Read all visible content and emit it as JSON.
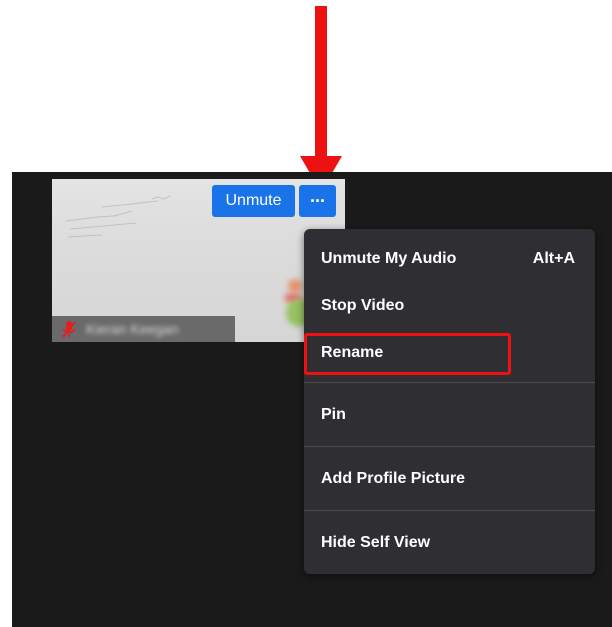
{
  "tile": {
    "unmute_label": "Unmute",
    "more_label": "···",
    "participant_name": "Kieran Keegan",
    "icons": {
      "mic": "mic-muted-icon"
    }
  },
  "menu": {
    "items": [
      {
        "label": "Unmute My Audio",
        "shortcut": "Alt+A"
      },
      {
        "label": "Stop Video"
      },
      {
        "label": "Rename"
      },
      {
        "label": "Pin"
      },
      {
        "label": "Add Profile Picture"
      },
      {
        "label": "Hide Self View"
      }
    ]
  },
  "colors": {
    "annotation": "#ee1111",
    "accent": "#1a73e8",
    "menu_bg": "#2f2f33",
    "meeting_bg": "#1a1a1a"
  }
}
